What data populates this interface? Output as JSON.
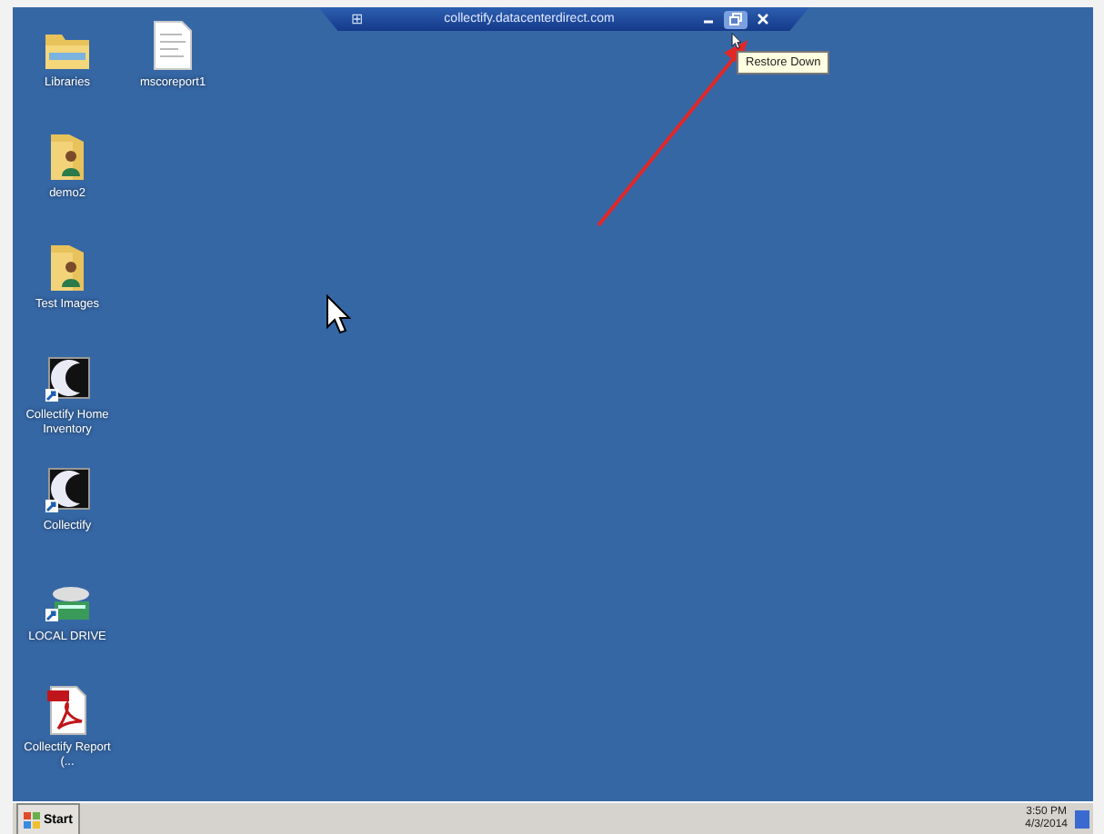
{
  "connection_bar": {
    "pin_glyph": "⊞",
    "title": "collectify.datacenterdirect.com",
    "buttons": [
      {
        "kind": "minimize",
        "hovered": false
      },
      {
        "kind": "restore",
        "hovered": true
      },
      {
        "kind": "close",
        "hovered": false
      }
    ]
  },
  "tooltip": {
    "text": "Restore Down"
  },
  "desktop_icons": [
    {
      "label": "Libraries",
      "kind": "folder"
    },
    {
      "label": "mscoreport1",
      "kind": "document"
    },
    {
      "label": "demo2",
      "kind": "folder-person"
    },
    {
      "label": "Test Images",
      "kind": "folder-person"
    },
    {
      "label": "Collectify Home Inventory",
      "kind": "app-shortcut"
    },
    {
      "label": "Collectify",
      "kind": "app-shortcut"
    },
    {
      "label": "LOCAL DRIVE",
      "kind": "drive"
    },
    {
      "label": "Collectify Report (...",
      "kind": "pdf"
    }
  ],
  "taskbar": {
    "start_label": "Start",
    "time": "3:50 PM",
    "date": "4/3/2014"
  }
}
